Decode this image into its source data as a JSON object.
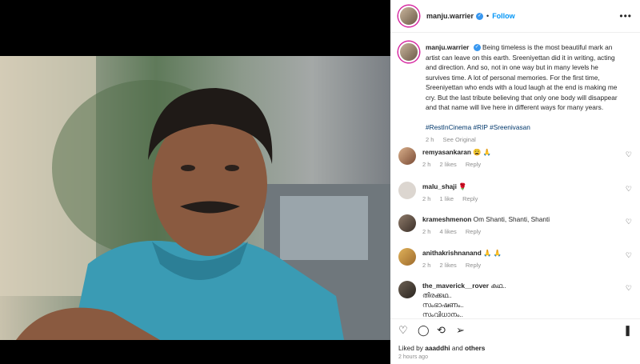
{
  "post": {
    "username": "manju.warrier",
    "follow_label": "Follow",
    "dot": "•",
    "more": "•••",
    "caption_text": "Being timeless is the most beautiful mark an artist can leave on this earth. Sreeniyettan did it in writing, acting and direction. And so, not in one way but in many levels he survives time. A lot of personal memories. For the first time, Sreeniyettan who ends with a loud laugh at the end is making me cry. But the last tribute believing that only one body will disappear and that name will live here in different ways for many years.",
    "hashtags": "#RestInCinema #RIP #Sreenivasan",
    "caption_time": "2 h",
    "see_original": "See Original",
    "liked_by_prefix": "Liked by ",
    "liked_by_user": "aaaddhi",
    "liked_by_suffix": " and ",
    "liked_by_others": "others",
    "time_ago": "2 hours ago"
  },
  "comments": [
    {
      "user": "remyasankaran",
      "text": "😩 🙏",
      "time": "2 h",
      "likes": "2 likes",
      "reply": "Reply"
    },
    {
      "user": "malu_shaji",
      "text": "🌹",
      "time": "2 h",
      "likes": "1 like",
      "reply": "Reply"
    },
    {
      "user": "krameshmenon",
      "text": "Om Shanti, Shanti, Shanti",
      "time": "2 h",
      "likes": "4 likes",
      "reply": "Reply"
    },
    {
      "user": "anithakrishnanand",
      "text": "🙏 🙏",
      "time": "2 h",
      "likes": "2 likes",
      "reply": "Reply"
    },
    {
      "user": "the_maverick__rover",
      "text": "കഥ..",
      "line2": "തിരക്കഥ..",
      "line3": "സംഭാഷണം..",
      "line4": "സംവിധാനം.."
    }
  ],
  "icons": {
    "heart": "heart-icon",
    "comment": "comment-icon",
    "share": "share-icon",
    "send": "send-icon",
    "save": "bookmark-icon"
  },
  "colors": {
    "accent": "#0095f6",
    "verified": "#3897f0",
    "hashtag": "#00376b"
  }
}
